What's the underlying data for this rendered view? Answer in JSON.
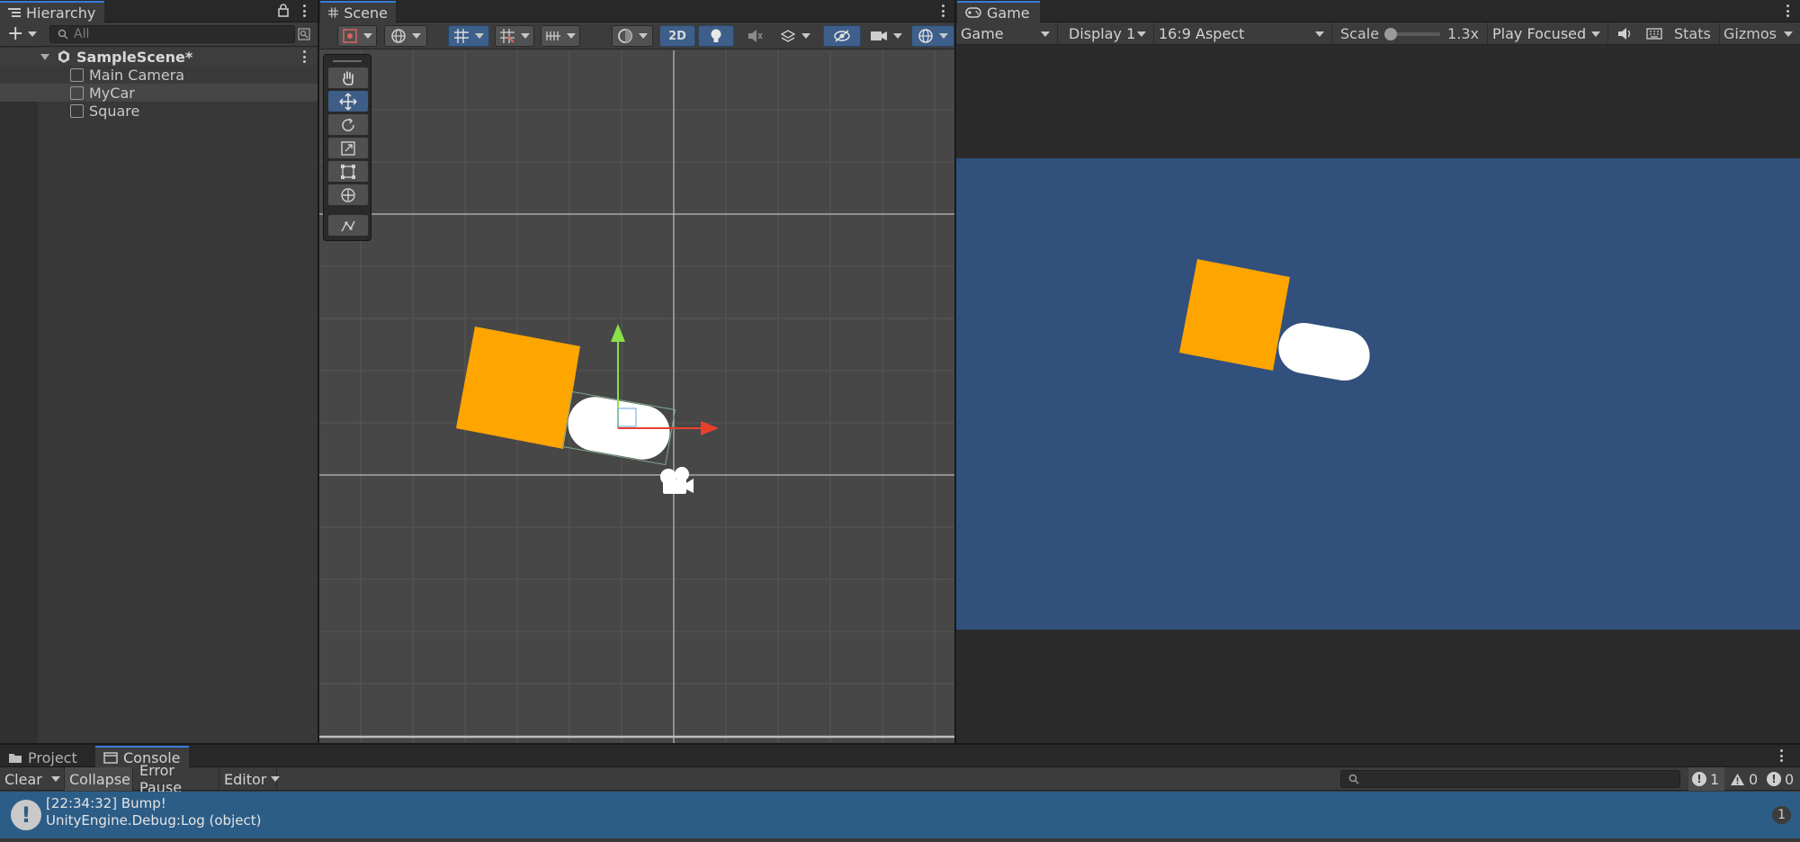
{
  "hierarchy": {
    "tab_label": "Hierarchy",
    "add_label": "+",
    "search_placeholder": "All",
    "scene_name": "SampleScene*",
    "items": [
      {
        "label": "Main Camera"
      },
      {
        "label": "MyCar"
      },
      {
        "label": "Square"
      }
    ]
  },
  "scene": {
    "tab_label": "Scene",
    "toggle_2d": "2D",
    "tools": [
      "hand-tool",
      "move-tool",
      "rotate-tool",
      "scale-tool",
      "rect-tool",
      "transform-tool",
      "custom-tool"
    ],
    "active_tool": "move-tool",
    "colors": {
      "square": "#ffa500",
      "car": "#ffffff",
      "x_axis": "#e8412b",
      "y_axis": "#8be04a",
      "grid": "#575757"
    }
  },
  "game": {
    "tab_label": "Game",
    "view_select": "Game",
    "display_select": "Display 1",
    "aspect_select": "16:9 Aspect",
    "scale_label": "Scale",
    "scale_value": "1.3x",
    "play_mode": "Play Focused",
    "stats_label": "Stats",
    "gizmos_label": "Gizmos",
    "colors": {
      "background": "#31507c",
      "square": "#ffa500",
      "car": "#ffffff"
    }
  },
  "bottom": {
    "tabs": [
      {
        "label": "Project"
      },
      {
        "label": "Console"
      }
    ],
    "active_tab": "Console",
    "clear_label": "Clear",
    "collapse_label": "Collapse",
    "error_pause_label": "Error Pause",
    "editor_label": "Editor",
    "counts": {
      "log": "1",
      "warning": "0",
      "error": "0"
    },
    "log": {
      "line1": "[22:34:32] Bump!",
      "line2": "UnityEngine.Debug:Log (object)",
      "count": "1"
    }
  }
}
